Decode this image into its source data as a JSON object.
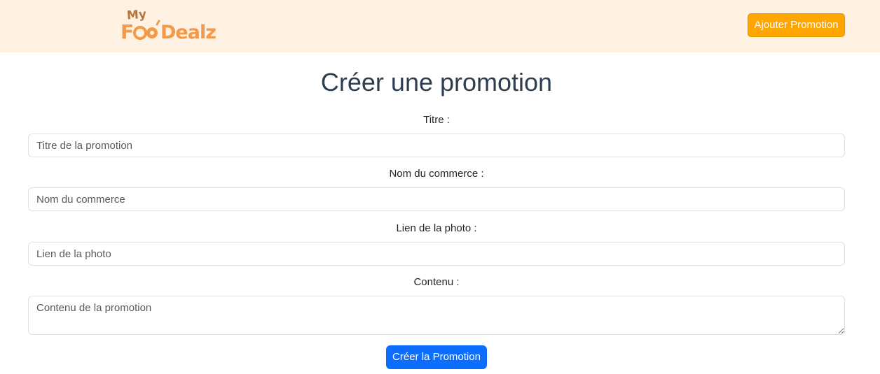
{
  "brand": {
    "logo_text": "My FooDealz",
    "accent": "#ffa500",
    "logo_color": "#f39a4a"
  },
  "navbar": {
    "add_button_label": "Ajouter Promotion"
  },
  "page": {
    "title": "Créer une promotion"
  },
  "form": {
    "title_label": "Titre :",
    "title_placeholder": "Titre de la promotion",
    "shop_label": "Nom du commerce :",
    "shop_placeholder": "Nom du commerce",
    "photo_label": "Lien de la photo :",
    "photo_placeholder": "Lien de la photo",
    "content_label": "Contenu :",
    "content_placeholder": "Contenu de la promotion",
    "submit_label": "Créer la Promotion"
  }
}
